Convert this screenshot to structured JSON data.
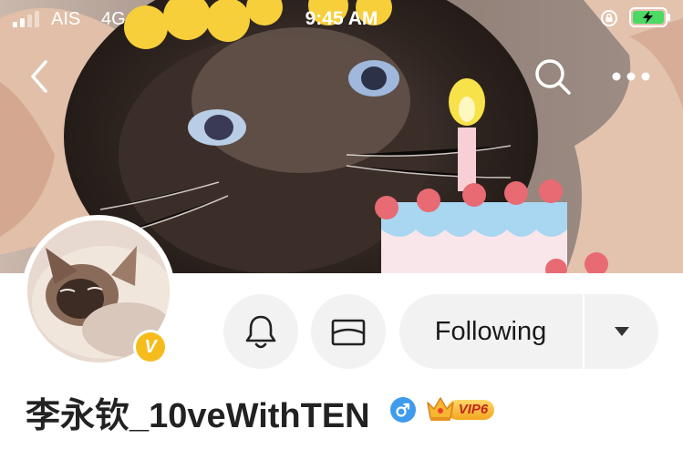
{
  "status_bar": {
    "carrier": "AIS",
    "network": "4G",
    "time": "9:45 AM"
  },
  "nav": {
    "back_icon": "chevron-left-icon",
    "search_icon": "search-icon",
    "more_icon": "more-dots-icon"
  },
  "profile": {
    "name": "李永钦_10veWithTEN",
    "verified_badge": "V",
    "gender": "male",
    "vip_label": "VIP6",
    "cover_image": "cat photo with flower crown and birthday cake stickers",
    "avatar_image": "cat photo"
  },
  "actions": {
    "notify_icon": "bell-icon",
    "message_icon": "envelope-icon",
    "follow_label": "Following",
    "follow_menu_icon": "caret-down-icon"
  },
  "colors": {
    "verified": "#f5bc1c",
    "gender": "#3f9bec",
    "button_bg": "#f2f2f2",
    "vip": "#f4a61f"
  }
}
